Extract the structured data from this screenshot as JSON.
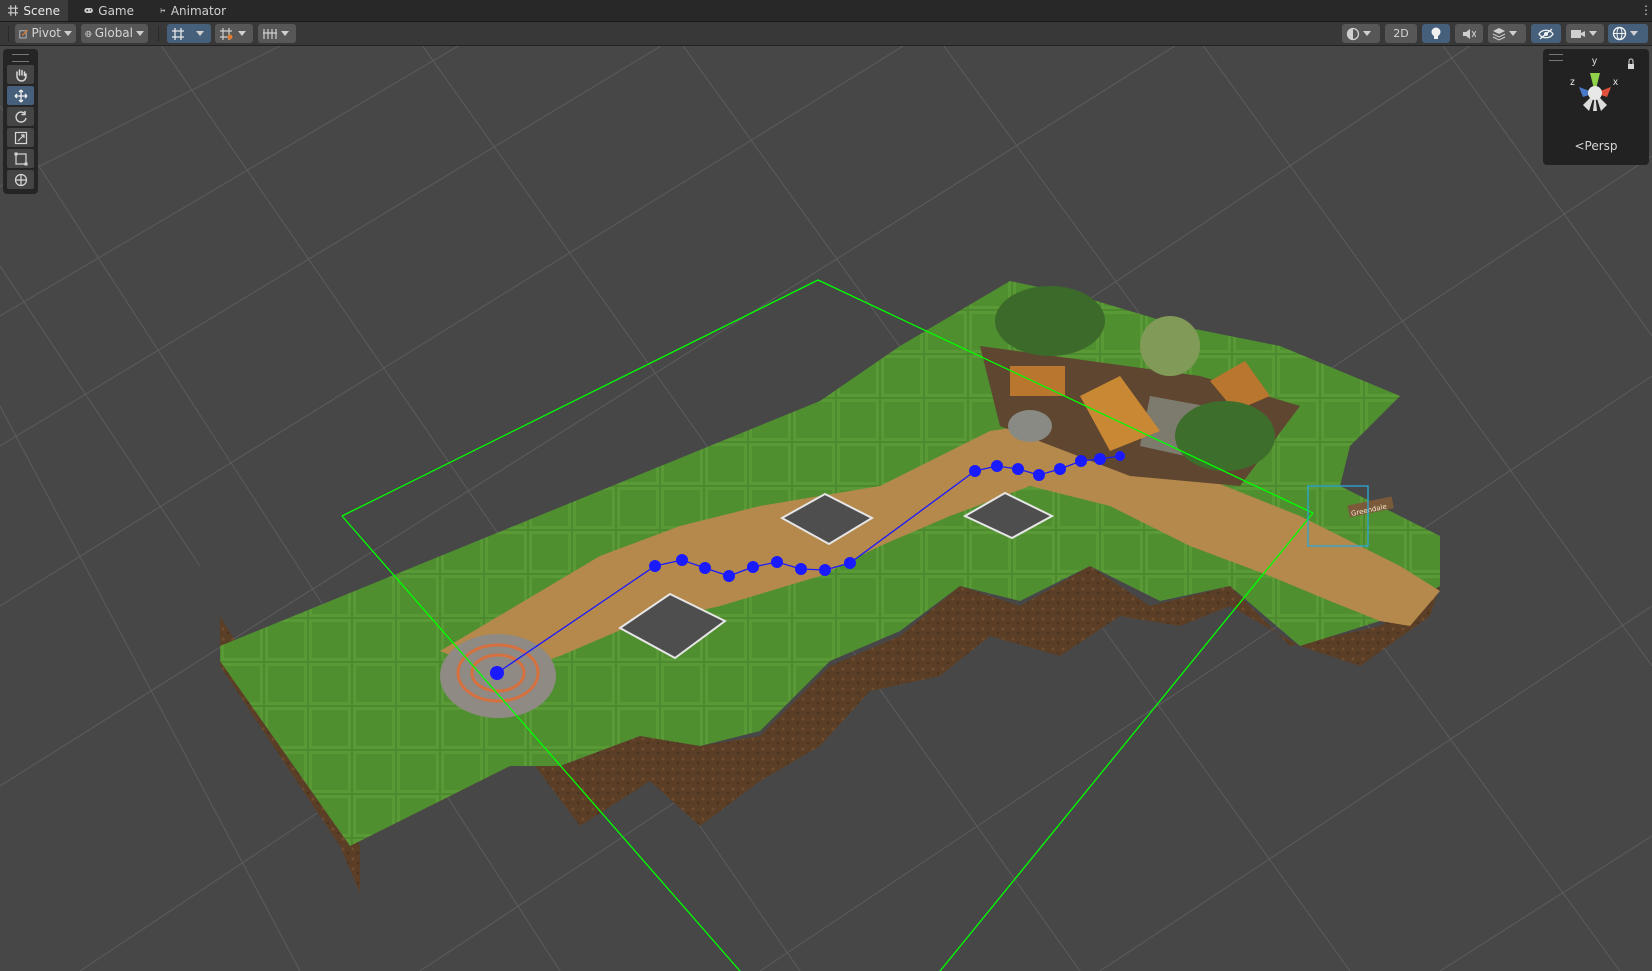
{
  "tabs": [
    {
      "label": "Scene",
      "icon": "grid-icon",
      "active": true
    },
    {
      "label": "Game",
      "icon": "gamepad-icon",
      "active": false
    },
    {
      "label": "Animator",
      "icon": "animator-icon",
      "active": false
    }
  ],
  "toolbar": {
    "pivot_label": "Pivot",
    "global_label": "Global",
    "mode_2d_label": "2D"
  },
  "gizmo": {
    "projection_label": "Persp",
    "axes": {
      "x": "x",
      "y": "y",
      "z": "z"
    }
  },
  "scene": {
    "signpost_label": "Greendale"
  },
  "colors": {
    "accent_blue": "#46607c",
    "waypoint_blue": "#1a1aff",
    "frustum_green": "#00ff00",
    "grass": "#4a8a2e",
    "path": "#b88e4f"
  }
}
